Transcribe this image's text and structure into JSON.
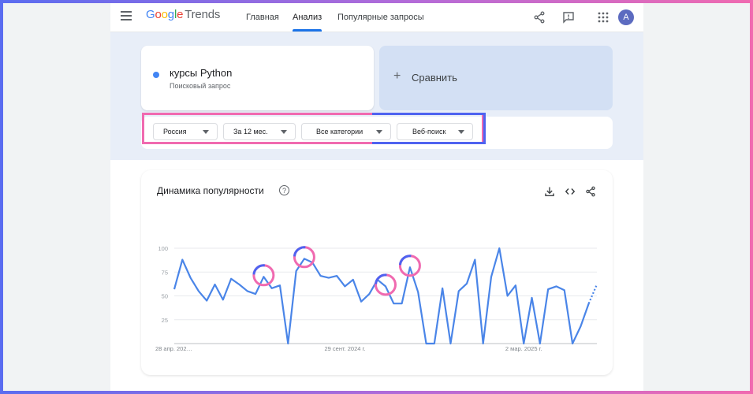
{
  "header": {
    "logo_google": [
      "G",
      "o",
      "o",
      "g",
      "l",
      "e"
    ],
    "logo_trends": "Trends",
    "nav": {
      "home": "Главная",
      "analyze": "Анализ",
      "popular": "Популярные запросы"
    },
    "avatar_letter": "A"
  },
  "search": {
    "term": "курсы Python",
    "term_type": "Поисковый запрос",
    "term_color": "#4285f4",
    "compare_label": "Сравнить"
  },
  "filters": {
    "region": "Россия",
    "period": "За 12 мес.",
    "category": "Все категории",
    "source": "Веб-поиск"
  },
  "chart_card": {
    "title": "Динамика популярности"
  },
  "colors": {
    "line": "#4a85e8",
    "highlight_pink": "#f06ab0",
    "highlight_blue": "#4f63f0",
    "band": "#e8eef8"
  },
  "chart_data": {
    "type": "line",
    "y_ticks": [
      100,
      75,
      50,
      25
    ],
    "ylim": [
      0,
      100
    ],
    "x_tick_labels": [
      "28 апр. 202…",
      "29 сент. 2024 г.",
      "2 мар. 2025 г."
    ],
    "x_tick_index": [
      0,
      21,
      43
    ],
    "grid": true,
    "series": [
      {
        "values": [
          57,
          88,
          69,
          55,
          45,
          62,
          46,
          68,
          62,
          55,
          52,
          70,
          58,
          61,
          0,
          76,
          89,
          85,
          71,
          69,
          71,
          60,
          67,
          44,
          52,
          67,
          60,
          42,
          42,
          80,
          54,
          0,
          0,
          58,
          0,
          55,
          63,
          88,
          0,
          70,
          100,
          50,
          61,
          0,
          48,
          0,
          57,
          60,
          56,
          0,
          18,
          42,
          62
        ],
        "projected_from_index": 51
      }
    ],
    "highlighted_points_index": [
      11,
      16,
      26,
      29
    ]
  }
}
